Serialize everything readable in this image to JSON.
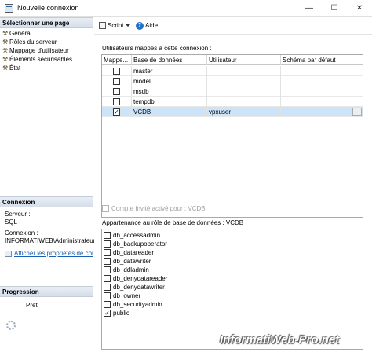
{
  "window": {
    "title": "Nouvelle connexion",
    "min": "—",
    "max": "☐",
    "close": "✕"
  },
  "left": {
    "select_page_title": "Sélectionner une page",
    "pages": [
      {
        "label": "Général"
      },
      {
        "label": "Rôles du serveur"
      },
      {
        "label": "Mappage d'utilisateur"
      },
      {
        "label": "Éléments sécurisables"
      },
      {
        "label": "État"
      }
    ],
    "connection_title": "Connexion",
    "server_label": "Serveur :",
    "server_value": "SQL",
    "conn_label": "Connexion :",
    "conn_value": "INFORMATIWEB\\Administrateur",
    "props_link": "Afficher les propriétés de conn",
    "progress_title": "Progression",
    "progress_status": "Prêt"
  },
  "toolbar": {
    "script": "Script",
    "help": "Aide"
  },
  "mapping": {
    "label": "Utilisateurs mappés à cette connexion :",
    "columns": [
      "Mappe...",
      "Base de données",
      "Utilisateur",
      "Schéma par défaut"
    ],
    "rows": [
      {
        "checked": false,
        "db": "master",
        "user": "",
        "schema": ""
      },
      {
        "checked": false,
        "db": "model",
        "user": "",
        "schema": ""
      },
      {
        "checked": false,
        "db": "msdb",
        "user": "",
        "schema": ""
      },
      {
        "checked": false,
        "db": "tempdb",
        "user": "",
        "schema": ""
      },
      {
        "checked": true,
        "db": "VCDB",
        "user": "vpxuser",
        "schema": ""
      }
    ],
    "ellipsis": "..."
  },
  "guest": {
    "label": "Compte Invité activé pour : VCDB"
  },
  "roles": {
    "label": "Appartenance au rôle de base de données : VCDB",
    "items": [
      {
        "name": "db_accessadmin",
        "checked": false
      },
      {
        "name": "db_backupoperator",
        "checked": false
      },
      {
        "name": "db_datareader",
        "checked": false
      },
      {
        "name": "db_datawriter",
        "checked": false
      },
      {
        "name": "db_ddladmin",
        "checked": false
      },
      {
        "name": "db_denydatareader",
        "checked": false
      },
      {
        "name": "db_denydatawriter",
        "checked": false
      },
      {
        "name": "db_owner",
        "checked": false
      },
      {
        "name": "db_securityadmin",
        "checked": false
      },
      {
        "name": "public",
        "checked": true
      }
    ]
  },
  "watermark": "InformatiWeb-Pro.net"
}
